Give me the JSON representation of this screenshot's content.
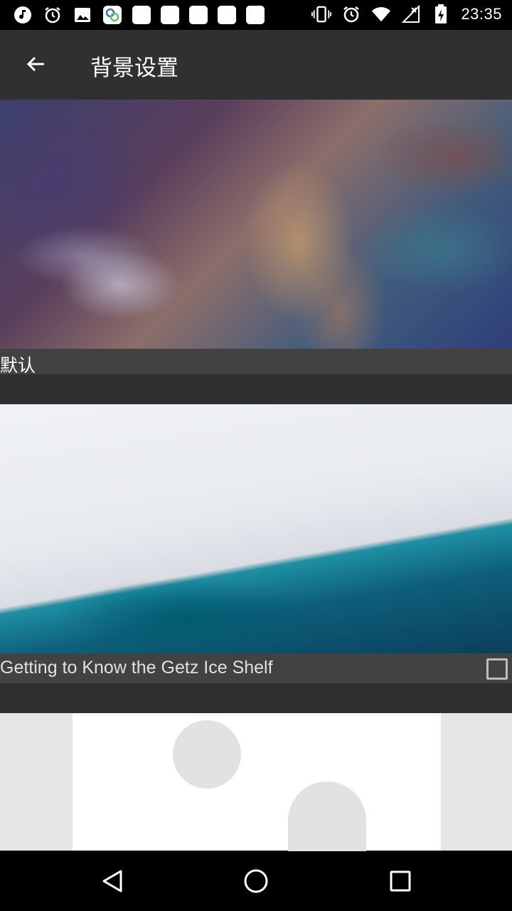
{
  "status_bar": {
    "time": "23:35",
    "left_icons": [
      "music-note-icon",
      "alarm-icon",
      "image-icon",
      "cloud-app-icon",
      "app-icon",
      "app-icon",
      "app-icon",
      "app-icon",
      "app-icon"
    ],
    "right_icons": [
      "vibrate-icon",
      "alarm-icon",
      "wifi-icon",
      "no-signal-icon",
      "battery-charging-icon"
    ]
  },
  "toolbar": {
    "title": "背景设置",
    "back_icon": "arrow-left-icon"
  },
  "backgrounds": [
    {
      "caption": "默认",
      "checkbox": false
    },
    {
      "caption": "Getting to Know the Getz Ice Shelf",
      "checkbox": true,
      "checked": false
    },
    {
      "caption": "",
      "placeholder": "image-placeholder-icon"
    }
  ],
  "nav_bar": {
    "icons": [
      "back-triangle-icon",
      "home-circle-icon",
      "recents-square-icon"
    ]
  },
  "colors": {
    "background": "#2f2f2f",
    "toolbar": "#303030",
    "caption_bar": "#424242",
    "status_bar": "#000000"
  }
}
